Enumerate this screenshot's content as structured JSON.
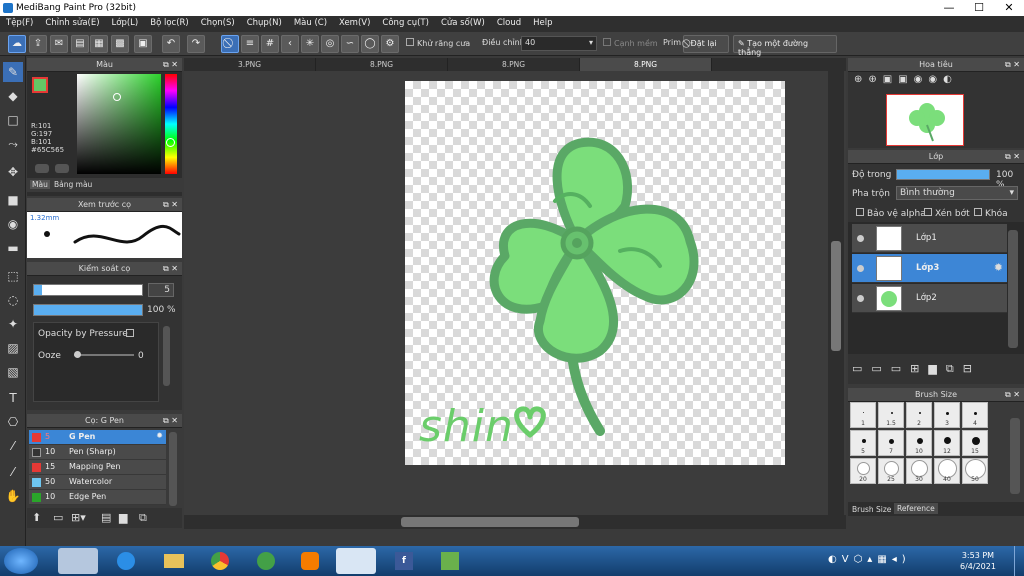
{
  "window": {
    "title": "MediBang Paint Pro (32bit)",
    "min": "—",
    "max": "☐",
    "close": "✕"
  },
  "menu": [
    "Tệp(F)",
    "Chỉnh sửa(E)",
    "Lớp(L)",
    "Bộ lọc(R)",
    "Chọn(S)",
    "Chụp(N)",
    "Màu (C)",
    "Xem(V)",
    "Công cụ(T)",
    "Cửa số(W)",
    "Cloud",
    "Help"
  ],
  "toolbar": {
    "antialias": "Khử răng cưa",
    "correction_label": "Điều chỉnh",
    "correction_value": "40",
    "edge_label": "Cạnh mềm",
    "prim": "Prim",
    "reset": "Đặt lại",
    "make_line": "Tạo một đường thẳng"
  },
  "color_panel": {
    "title": "Màu",
    "r": "R:101",
    "g": "G:197",
    "b": "B:101",
    "hex": "#65C565",
    "tab_color": "Màu",
    "tab_palette": "Bảng màu",
    "fg": "#65c565",
    "bg": "#ffffff"
  },
  "brush_preview": {
    "title": "Xem trước cọ",
    "size": "1.32mm"
  },
  "brush_control": {
    "title": "Kiểm soát cọ",
    "size_value": "5",
    "opacity_value": "100 %",
    "opacity_pressure": "Opacity by Pressure",
    "ooze": "Ooze",
    "ooze_value": "0"
  },
  "brush_list": {
    "title": "Cọ: G Pen",
    "items": [
      {
        "size": "5",
        "name": "G Pen",
        "color": "#e53935",
        "selected": true
      },
      {
        "size": "10",
        "name": "Pen (Sharp)",
        "color": "#333333",
        "selected": false
      },
      {
        "size": "15",
        "name": "Mapping Pen",
        "color": "#e53935",
        "selected": false
      },
      {
        "size": "50",
        "name": "Watercolor",
        "color": "#6ec6f0",
        "selected": false
      },
      {
        "size": "10",
        "name": "Edge Pen",
        "color": "#2aa52a",
        "selected": false
      }
    ]
  },
  "doc_tabs": [
    "3.PNG",
    "8.PNG",
    "8.PNG",
    "8.PNG"
  ],
  "navigator": {
    "title": "Hoa tiêu"
  },
  "layers": {
    "title": "Lớp",
    "opacity_label": "Độ trong",
    "opacity_value": "100 %",
    "blend_label": "Pha trộn",
    "blend_value": "Bình thường",
    "protect_alpha": "Bảo vệ alpha",
    "clipping": "Xén bớt",
    "lock": "Khóa",
    "items": [
      {
        "name": "Lớp1",
        "selected": false
      },
      {
        "name": "Lớp3",
        "selected": true
      },
      {
        "name": "Lớp2",
        "selected": false
      }
    ]
  },
  "brush_size": {
    "title": "Brush Size",
    "tab_size": "Brush Size",
    "tab_reference": "Reference",
    "values": [
      "1",
      "1.5",
      "2",
      "3",
      "4",
      "5",
      "7",
      "10",
      "12",
      "15",
      "20",
      "25",
      "30",
      "40",
      "50"
    ]
  },
  "canvas_text": "shin",
  "taskbar": {
    "time": "3:53 PM",
    "date": "6/4/2021"
  }
}
